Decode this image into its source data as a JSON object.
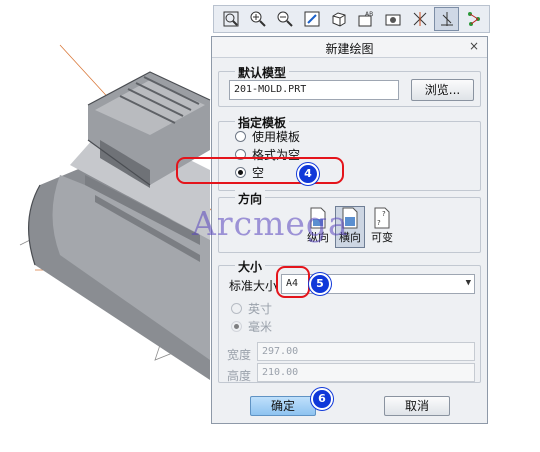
{
  "toolbar": {
    "icons": [
      "refit-icon",
      "zoom-in-icon",
      "zoom-out-icon",
      "repaint-icon",
      "shading-icon",
      "saved-views-icon",
      "layers-icon",
      "datum-planes-icon",
      "datum-axes-icon",
      "datum-points-icon"
    ],
    "active_icon": "datum-axes-icon"
  },
  "dialog": {
    "title": "新建绘图",
    "close_glyph": "×",
    "default_model": {
      "label": "默认模型",
      "value": "201-MOLD.PRT",
      "browse_label": "浏览..."
    },
    "template": {
      "label": "指定模板",
      "options": [
        "使用模板",
        "格式为空",
        "空"
      ],
      "selected": "空"
    },
    "orientation": {
      "label": "方向",
      "options": [
        "纵向",
        "横向",
        "可变"
      ],
      "selected": "横向"
    },
    "size": {
      "label": "大小",
      "standard_label": "标准大小",
      "standard_value": "A4",
      "units": [
        "英寸",
        "毫米"
      ],
      "unit_selected": "毫米",
      "width_label": "宽度",
      "width_value": "297.00",
      "height_label": "高度",
      "height_value": "210.00"
    },
    "ok_label": "确定",
    "cancel_label": "取消"
  },
  "annotations": {
    "step4": "4",
    "step5": "5",
    "step6": "6"
  },
  "watermark": "Arcmega",
  "colors": {
    "annotation_red": "#e4141b",
    "badge_blue": "#1038d9",
    "ok_button_blue": "#8ec3f0"
  }
}
